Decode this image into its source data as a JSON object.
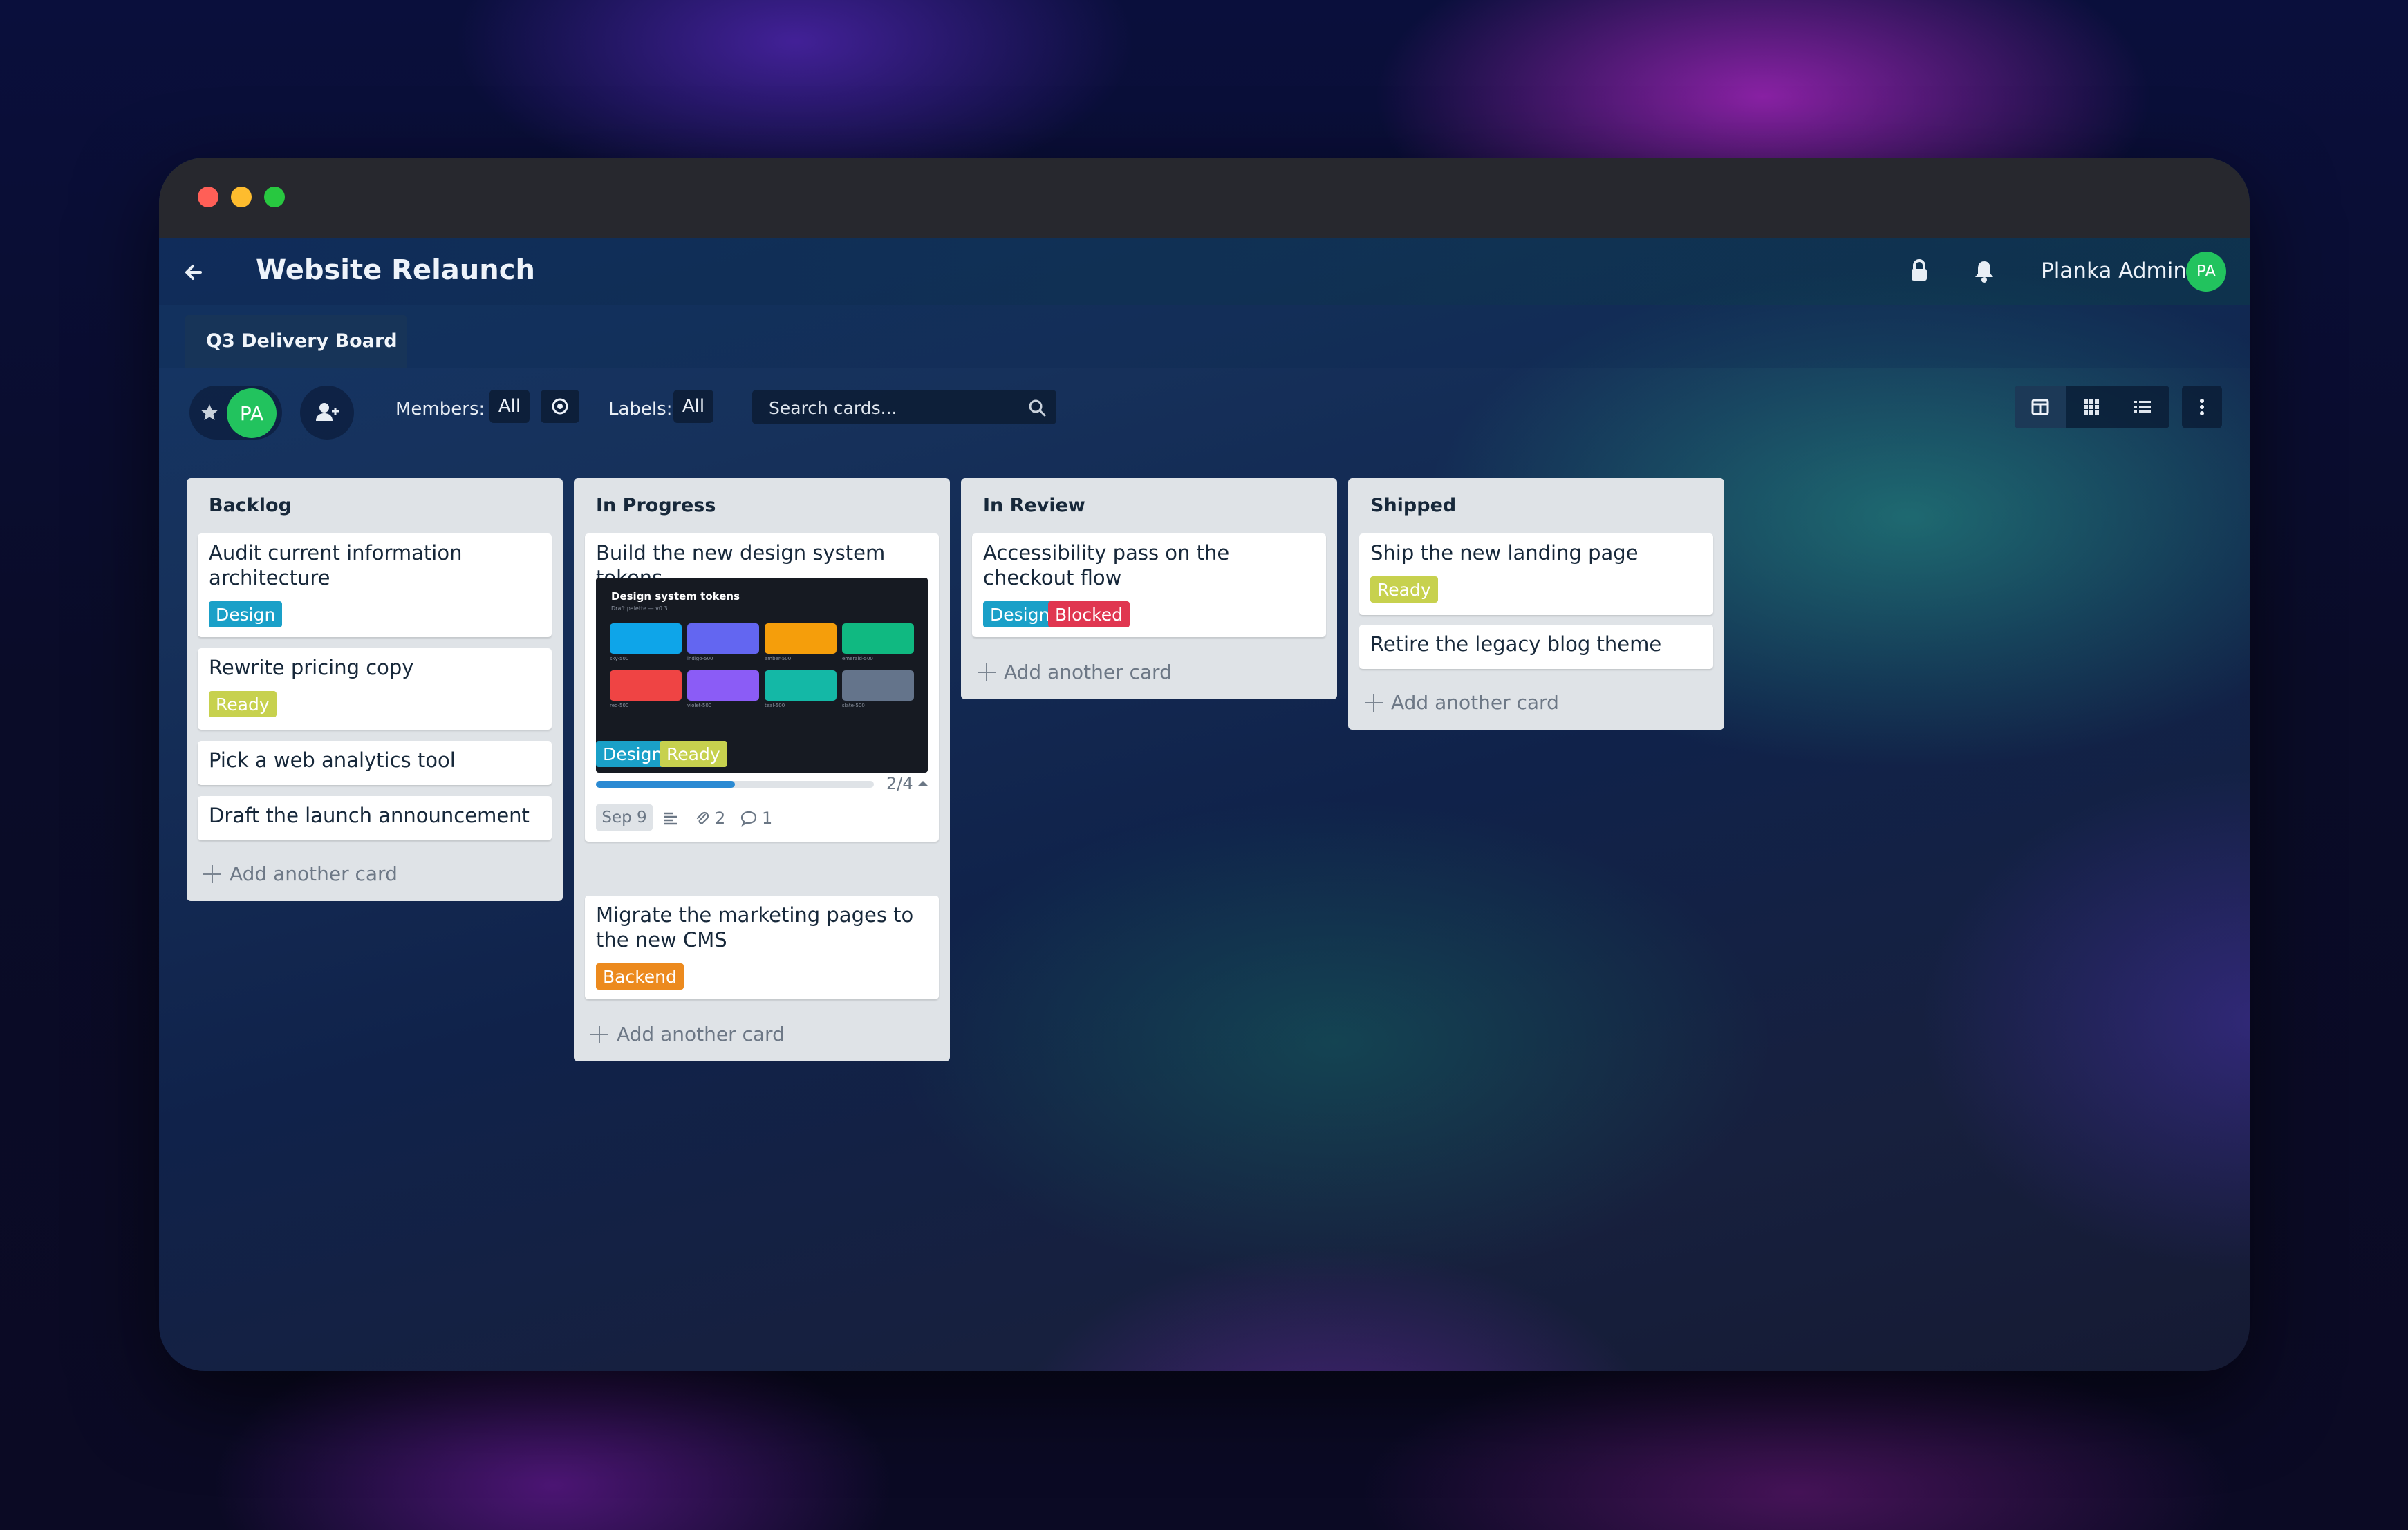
{
  "window": {
    "colors": {
      "close": "#ff5f57",
      "minimize": "#febc2e",
      "maximize": "#28c840"
    }
  },
  "header": {
    "project_title": "Website Relaunch",
    "user_name": "Planka Admin",
    "user_initials": "PA",
    "icons": [
      "arrow-left-icon",
      "lock-icon",
      "bell-icon"
    ]
  },
  "tabs": [
    {
      "label": "Q3 Delivery Board"
    }
  ],
  "toolbar": {
    "member_initials": "PA",
    "members_label": "Members:",
    "members_value": "All",
    "labels_label": "Labels:",
    "labels_value": "All",
    "search_placeholder": "Search cards...",
    "view_icons": [
      "board-view-icon",
      "grid-view-icon",
      "list-view-icon"
    ],
    "accent_color": "#22c35e"
  },
  "lists": [
    {
      "title": "Backlog",
      "cards": [
        {
          "title": "Audit current information architecture",
          "labels": [
            "Design"
          ]
        },
        {
          "title": "Rewrite pricing copy",
          "labels": [
            "Ready"
          ]
        },
        {
          "title": "Pick a web analytics tool",
          "labels": []
        },
        {
          "title": "Draft the launch announcement",
          "labels": []
        }
      ],
      "add_label": "Add another card"
    },
    {
      "title": "In Progress",
      "cards": [
        {
          "title": "Build the new design system tokens",
          "labels": [
            "Design",
            "Ready"
          ],
          "cover": {
            "title": "Design system tokens",
            "subtitle": "Draft palette — v0.3",
            "swatches": [
              {
                "name": "sky-500",
                "color": "#0ea5e9"
              },
              {
                "name": "indigo-500",
                "color": "#6366f1"
              },
              {
                "name": "amber-500",
                "color": "#f59e0b"
              },
              {
                "name": "emerald-500",
                "color": "#10b981"
              },
              {
                "name": "red-500",
                "color": "#ef4444"
              },
              {
                "name": "violet-500",
                "color": "#8b5cf6"
              },
              {
                "name": "teal-500",
                "color": "#14b8a6"
              },
              {
                "name": "slate-500",
                "color": "#64748b"
              }
            ]
          },
          "tasks": {
            "text": "2/4",
            "progress": 0.5
          },
          "due_date": "Sep 9",
          "attachments": "2",
          "comments": "1"
        },
        {
          "title": "Migrate the marketing pages to the new CMS",
          "labels": [
            "Backend"
          ]
        }
      ],
      "add_label": "Add another card"
    },
    {
      "title": "In Review",
      "cards": [
        {
          "title": "Accessibility pass on the checkout flow",
          "labels": [
            "Design",
            "Blocked"
          ]
        }
      ],
      "add_label": "Add another card"
    },
    {
      "title": "Shipped",
      "cards": [
        {
          "title": "Ship the new landing page",
          "labels": [
            "Ready"
          ]
        },
        {
          "title": "Retire the legacy blog theme",
          "labels": []
        }
      ],
      "add_label": "Add another card"
    }
  ],
  "label_colors": {
    "Design": "#1aa0c8",
    "Ready": "#c7d14e",
    "Blocked": "#e03650",
    "Backend": "#ec8a1e"
  }
}
